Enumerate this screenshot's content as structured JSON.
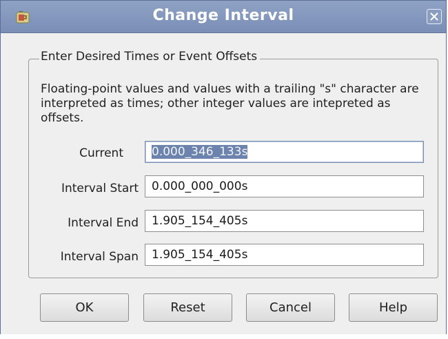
{
  "window": {
    "title": "Change Interval",
    "app_icon": "java-cup-icon",
    "close_icon": "close-icon",
    "titlebar_color": "#7f93ba"
  },
  "group": {
    "legend": "Enter Desired Times or Event Offsets",
    "description": "Floating-point values and values with a trailing \"s\" character are interpreted as times; other integer values are intepreted as offsets."
  },
  "fields": {
    "current": {
      "label": "Current",
      "value": "0.000_346_133s",
      "selected": true
    },
    "interval_start": {
      "label": "Interval Start",
      "value": "0.000_000_000s"
    },
    "interval_end": {
      "label": "Interval End",
      "value": "1.905_154_405s"
    },
    "interval_span": {
      "label": "Interval Span",
      "value": "1.905_154_405s"
    }
  },
  "buttons": {
    "ok": "OK",
    "reset": "Reset",
    "cancel": "Cancel",
    "help": "Help"
  },
  "colors": {
    "selection": "#6b83ad",
    "dialog_background": "#efefef"
  }
}
